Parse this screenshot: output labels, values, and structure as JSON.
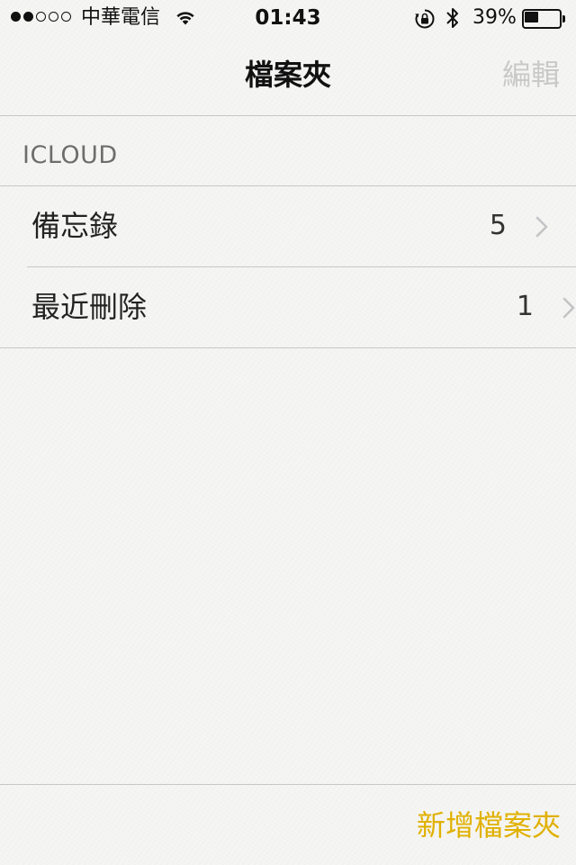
{
  "status_bar": {
    "signal_strength": 2,
    "signal_max": 5,
    "carrier": "中華電信",
    "time": "01:43",
    "battery_percent_text": "39%",
    "battery_level": 0.39,
    "icons": [
      "wifi-icon",
      "rotation-lock-icon",
      "bluetooth-icon",
      "battery-icon"
    ]
  },
  "nav_bar": {
    "title": "檔案夾",
    "edit_label": "編輯"
  },
  "section": {
    "header": "ICLOUD"
  },
  "folders": [
    {
      "name": "備忘錄",
      "count": "5"
    },
    {
      "name": "最近刪除",
      "count": "1"
    }
  ],
  "toolbar": {
    "new_folder_label": "新增檔案夾"
  },
  "colors": {
    "accent": "#e1b100",
    "disabled": "#c9c9c7",
    "separator": "#c8c7c2",
    "background": "#f4f4f2"
  }
}
